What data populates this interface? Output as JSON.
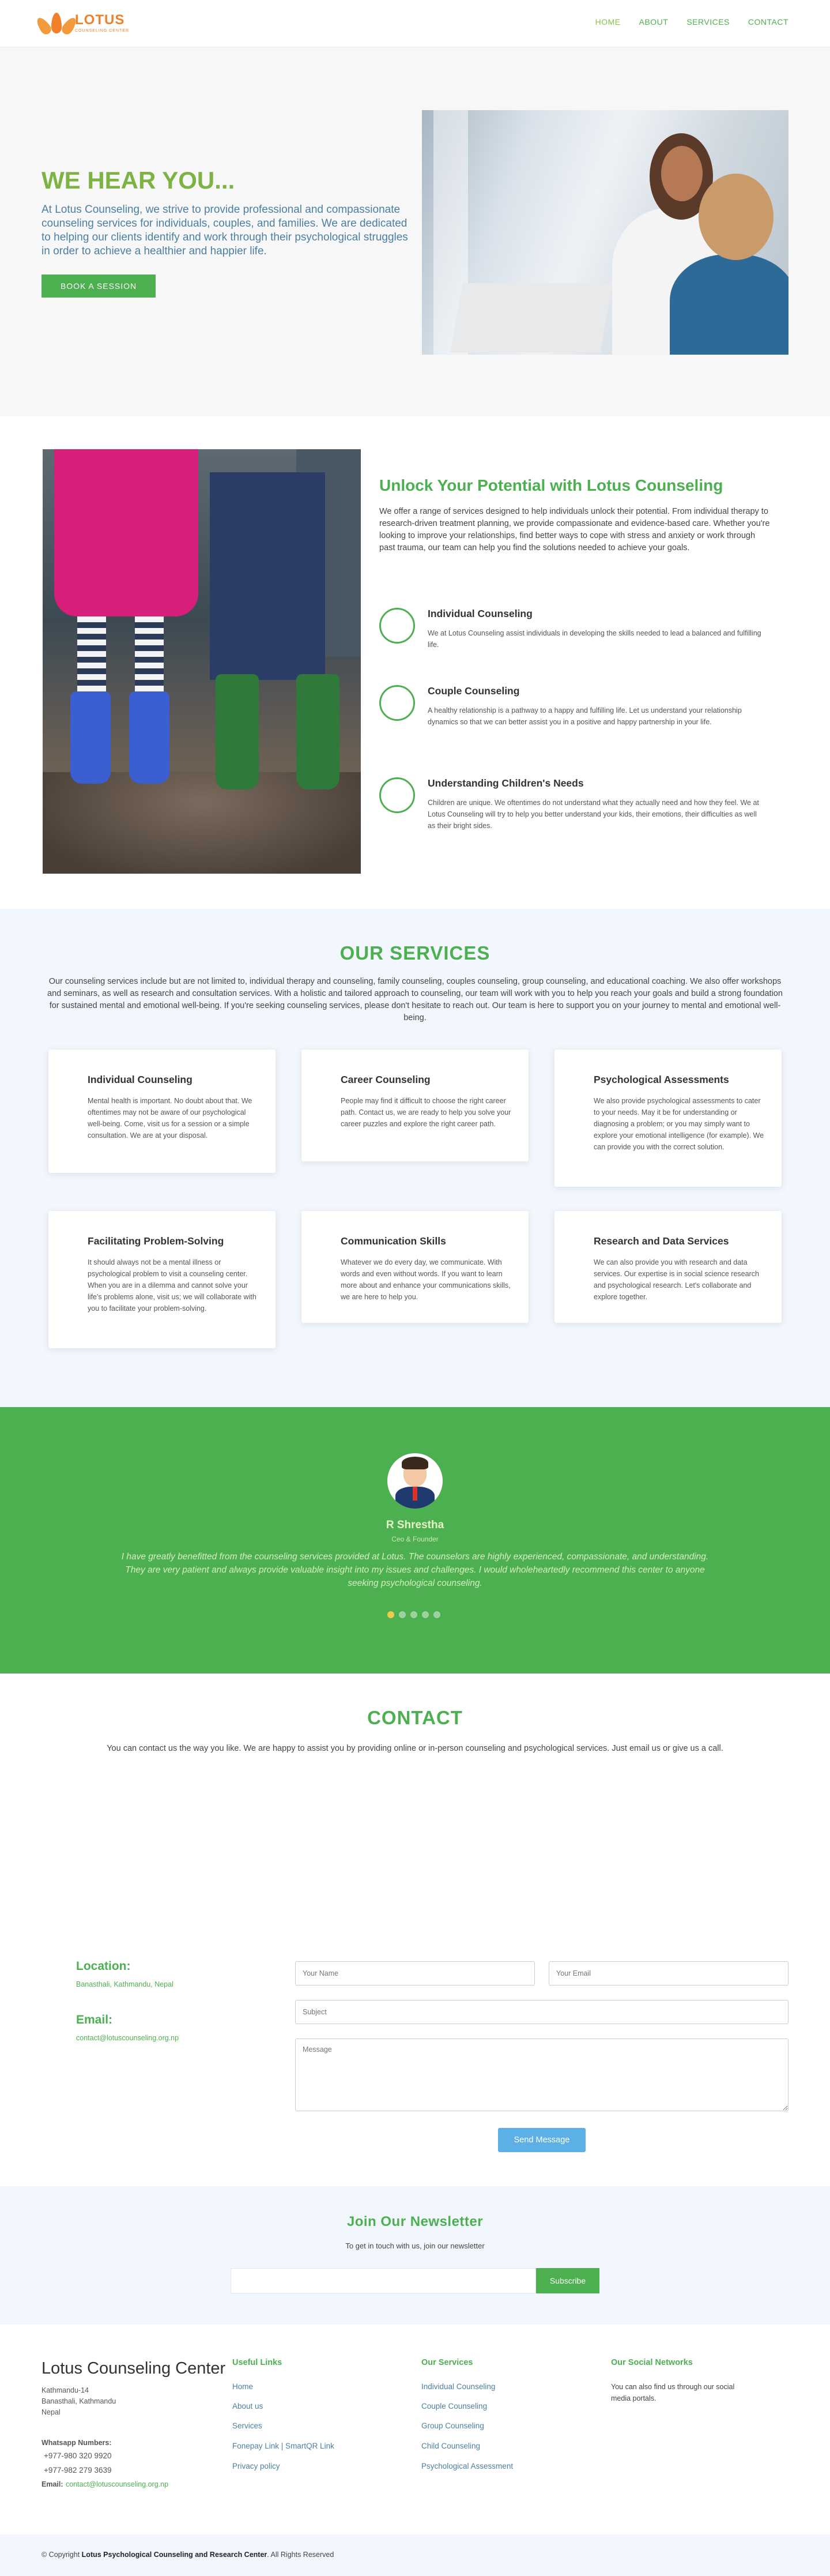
{
  "brand": {
    "name": "LOTUS",
    "sub": "COUNSELING CENTER"
  },
  "nav": [
    {
      "label": "HOME"
    },
    {
      "label": "ABOUT"
    },
    {
      "label": "SERVICES"
    },
    {
      "label": "CONTACT"
    }
  ],
  "hero": {
    "title": "WE HEAR YOU...",
    "text": "At Lotus Counseling, we strive to provide professional and compassionate counseling services for individuals, couples, and families. We are dedicated to helping our clients identify and work through their psychological struggles in order to achieve a healthier and happier life.",
    "button": "BOOK A SESSION"
  },
  "unlock": {
    "title": "Unlock Your Potential with Lotus Counseling",
    "text": "We offer a range of services designed to help individuals unlock their potential. From individual therapy to research-driven treatment planning, we provide compassionate and evidence-based care. Whether you're looking to improve your relationships, find better ways to cope with stress and anxiety or work through past trauma, our team can help you find the solutions needed to achieve your goals.",
    "features": [
      {
        "title": "Individual Counseling",
        "text": "We at Lotus Counseling assist individuals in developing the skills needed to lead a balanced and fulfilling life."
      },
      {
        "title": "Couple Counseling",
        "text": "A healthy relationship is a pathway to a happy and fulfilling life. Let us understand your relationship dynamics so that we can better assist you in a positive and happy partnership in your life."
      },
      {
        "title": "Understanding Children's Needs",
        "text": "Children are unique. We oftentimes do not understand what they actually need and how they feel. We at Lotus Counseling will try to help you better understand your kids, their emotions, their difficulties as well as their bright sides."
      }
    ]
  },
  "services": {
    "title": "OUR SERVICES",
    "intro": "Our counseling services include but are not limited to, individual therapy and counseling, family counseling, couples counseling, group counseling, and educational coaching. We also offer workshops and seminars, as well as research and consultation services. With a holistic and tailored approach to counseling, our team will work with you to help you reach your goals and build a strong foundation for sustained mental and emotional well-being. If you're seeking counseling services, please don't hesitate to reach out. Our team is here to support you on your journey to mental and emotional well-being.",
    "cards": [
      {
        "title": "Individual Counseling",
        "text": "Mental health is important. No doubt about that. We oftentimes may not be aware of our psychological well-being. Come, visit us for a session or a simple consultation. We are at your disposal."
      },
      {
        "title": "Career Counseling",
        "text": "People may find it difficult to choose the right career path. Contact us, we are ready to help you solve your career puzzles and explore the right career path."
      },
      {
        "title": "Psychological Assessments",
        "text": "We also provide psychological assessments to cater to your needs. May it be for understanding or diagnosing a problem; or you may simply want to explore your emotional intelligence (for example). We can provide you with the correct solution."
      },
      {
        "title": "Facilitating Problem-Solving",
        "text": "It should always not be a mental illness or psychological problem to visit a counseling center. When you are in a dilemma and cannot solve your life's problems alone, visit us; we will collaborate with you to facilitate your problem-solving."
      },
      {
        "title": "Communication Skills",
        "text": "Whatever we do every day, we communicate. With words and even without words. If you want to learn more about and enhance your communications skills, we are here to help you."
      },
      {
        "title": "Research and Data Services",
        "text": "We can also provide you with research and data services. Our expertise is in social science research and psychological research. Let's collaborate and explore together."
      }
    ]
  },
  "testimonial": {
    "name": "R Shrestha",
    "role": "Ceo & Founder",
    "quote": "I have greatly benefitted from the counseling services provided at Lotus. The counselors are highly experienced, compassionate, and understanding. They are very patient and always provide valuable insight into my issues and challenges. I would wholeheartedly recommend this center to anyone seeking psychological counseling."
  },
  "contact": {
    "title": "CONTACT",
    "intro": "You can contact us the way you like. We are happy to assist you by providing online or in-person counseling and psychological services. Just email us or give us a call.",
    "location_label": "Location:",
    "location_value": "Banasthali, Kathmandu, Nepal",
    "email_label": "Email:",
    "email_value": "contact@lotuscounseling.org.np",
    "form": {
      "name_placeholder": "Your Name",
      "email_placeholder": "Your Email",
      "subject_placeholder": "Subject",
      "message_placeholder": "Message",
      "send": "Send Message"
    }
  },
  "newsletter": {
    "title": "Join Our Newsletter",
    "sub": "To get in touch with us, join our newsletter",
    "button": "Subscribe"
  },
  "footer": {
    "title": "Lotus Counseling Center",
    "address1": "Kathmandu-14",
    "address2": "Banasthali, Kathmandu",
    "address3": "Nepal",
    "whatsapp_label": "Whatsapp Numbers:",
    "phone1": "+977-980 320 9920",
    "phone2": "+977-982 279 3639",
    "email_label": "Email:",
    "email": "contact@lotuscounseling.org.np",
    "useful_title": "Useful Links",
    "useful": [
      "Home",
      "About us",
      "Services",
      "Fonepay Link | SmartQR Link",
      "Privacy policy"
    ],
    "services_title": "Our Services",
    "services": [
      "Individual Counseling",
      "Couple Counseling",
      "Group Counseling",
      "Child Counseling",
      "Psychological Assessment"
    ],
    "social_title": "Our Social Networks",
    "social_text": "You can also find us through our social media portals.",
    "copy_prefix": "© Copyright",
    "copy_org": "Lotus Psychological Counseling and Research Center",
    "copy_suffix": ". All Rights Reserved"
  },
  "colors": {
    "accent": "#4caf50",
    "brand": "#f0802a",
    "send": "#5cb0e6"
  }
}
